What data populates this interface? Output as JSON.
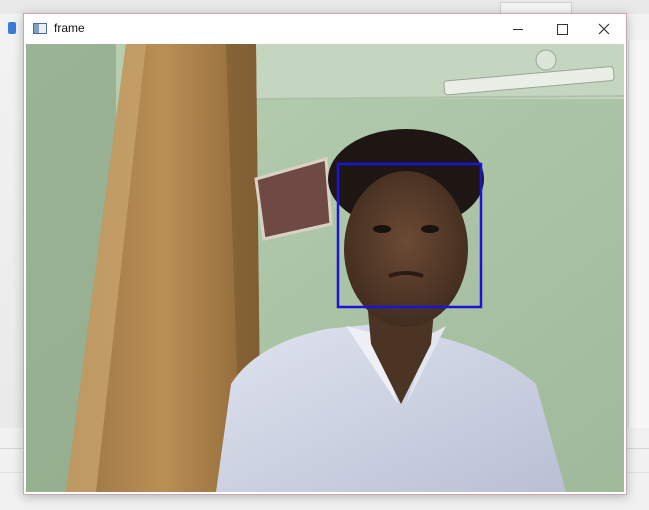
{
  "window": {
    "title": "frame",
    "icon": "app-window-icon",
    "controls": {
      "minimize": "minimize-icon",
      "maximize": "maximize-icon",
      "close": "close-icon"
    }
  },
  "frame": {
    "detection_box_color": "#1a14d6",
    "content": "webcam-image-with-face-detection"
  }
}
